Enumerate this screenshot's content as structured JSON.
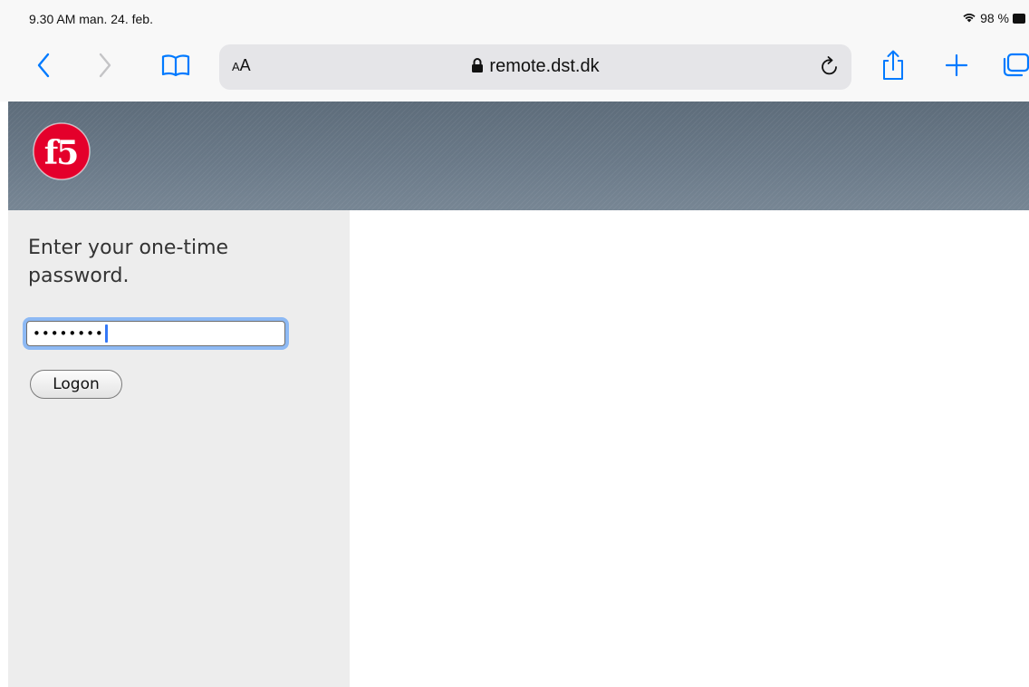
{
  "status_bar": {
    "time_date": "9.30 AM   man. 24. feb.",
    "battery_percent": "98 %",
    "wifi_icon": "wifi-icon",
    "battery_icon": "battery-icon"
  },
  "toolbar": {
    "back_icon": "chevron-left-icon",
    "forward_icon": "chevron-right-icon",
    "bookmarks_icon": "book-icon",
    "reader_small": "A",
    "reader_big": "A",
    "lock_icon": "lock-icon",
    "url": "remote.dst.dk",
    "reload_icon": "reload-icon",
    "share_icon": "share-icon",
    "new_tab_icon": "plus-icon",
    "tabs_icon": "tabs-icon",
    "accent_color": "#007aff"
  },
  "banner": {
    "logo_text": "f5",
    "logo_color": "#e4002b"
  },
  "login": {
    "prompt": "Enter your one-time password.",
    "password_mask": "••••••••",
    "logon_label": "Logon",
    "focus_color": "#8db9f4"
  }
}
